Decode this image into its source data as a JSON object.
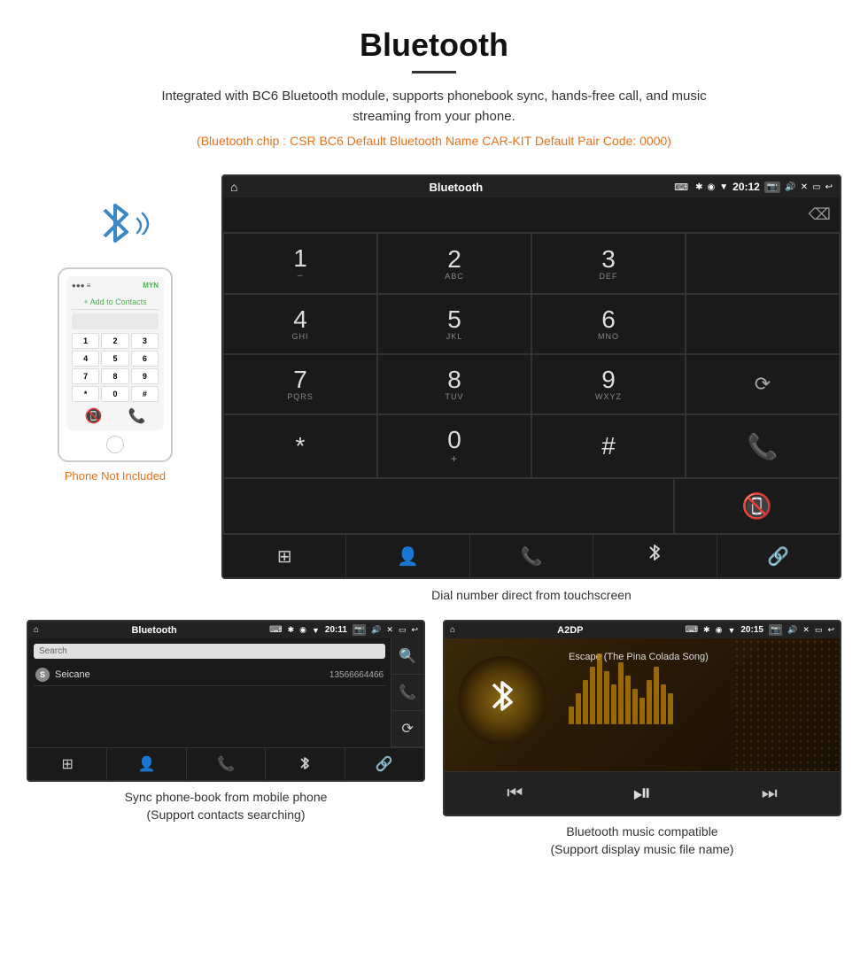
{
  "header": {
    "title": "Bluetooth",
    "description": "Integrated with BC6 Bluetooth module, supports phonebook sync, hands-free call, and music streaming from your phone.",
    "specs": "(Bluetooth chip : CSR BC6    Default Bluetooth Name CAR-KIT    Default Pair Code: 0000)"
  },
  "phone_section": {
    "not_included": "Phone Not Included",
    "add_contact": "+ Add to Contacts",
    "keys": [
      "1",
      "2",
      "3",
      "4",
      "5",
      "6",
      "7",
      "8",
      "9",
      "*",
      "0",
      "#"
    ]
  },
  "dial_screen": {
    "title": "Bluetooth",
    "time": "20:12",
    "rows": [
      {
        "main": "1",
        "sub": ""
      },
      {
        "main": "2",
        "sub": "ABC"
      },
      {
        "main": "3",
        "sub": "DEF"
      },
      {
        "main": "empty",
        "sub": ""
      },
      {
        "main": "4",
        "sub": "GHI"
      },
      {
        "main": "5",
        "sub": "JKL"
      },
      {
        "main": "6",
        "sub": "MNO"
      },
      {
        "main": "empty",
        "sub": ""
      },
      {
        "main": "7",
        "sub": "PQRS"
      },
      {
        "main": "8",
        "sub": "TUV"
      },
      {
        "main": "9",
        "sub": "WXYZ"
      },
      {
        "main": "reload",
        "sub": ""
      },
      {
        "main": "*",
        "sub": ""
      },
      {
        "main": "0",
        "sub": "+"
      },
      {
        "main": "#",
        "sub": ""
      },
      {
        "main": "call",
        "sub": ""
      },
      {
        "main": "end",
        "sub": ""
      }
    ],
    "caption": "Dial number direct from touchscreen"
  },
  "phonebook_screen": {
    "title": "Bluetooth",
    "time": "20:11",
    "search_placeholder": "Search",
    "contacts": [
      {
        "initial": "S",
        "name": "Seicane",
        "phone": "13566664466"
      }
    ],
    "caption": "Sync phone-book from mobile phone\n(Support contacts searching)"
  },
  "music_screen": {
    "title": "A2DP",
    "time": "20:15",
    "song_title": "Escape (The Pina Colada Song)",
    "visualizer_bars": [
      20,
      35,
      50,
      65,
      80,
      60,
      45,
      70,
      55,
      40,
      30,
      50,
      65,
      45,
      35
    ],
    "caption": "Bluetooth music compatible\n(Support display music file name)"
  },
  "icons": {
    "bluetooth": "✱",
    "home": "⌂",
    "usb": "⌨",
    "camera": "📷",
    "volume": "🔊",
    "back": "↩",
    "keypad": "⊞",
    "person": "👤",
    "phone": "📞",
    "bt": "✱",
    "link": "🔗",
    "search": "🔍",
    "prev": "⏮",
    "play": "⏯",
    "next": "⏭",
    "reload": "🔄"
  }
}
